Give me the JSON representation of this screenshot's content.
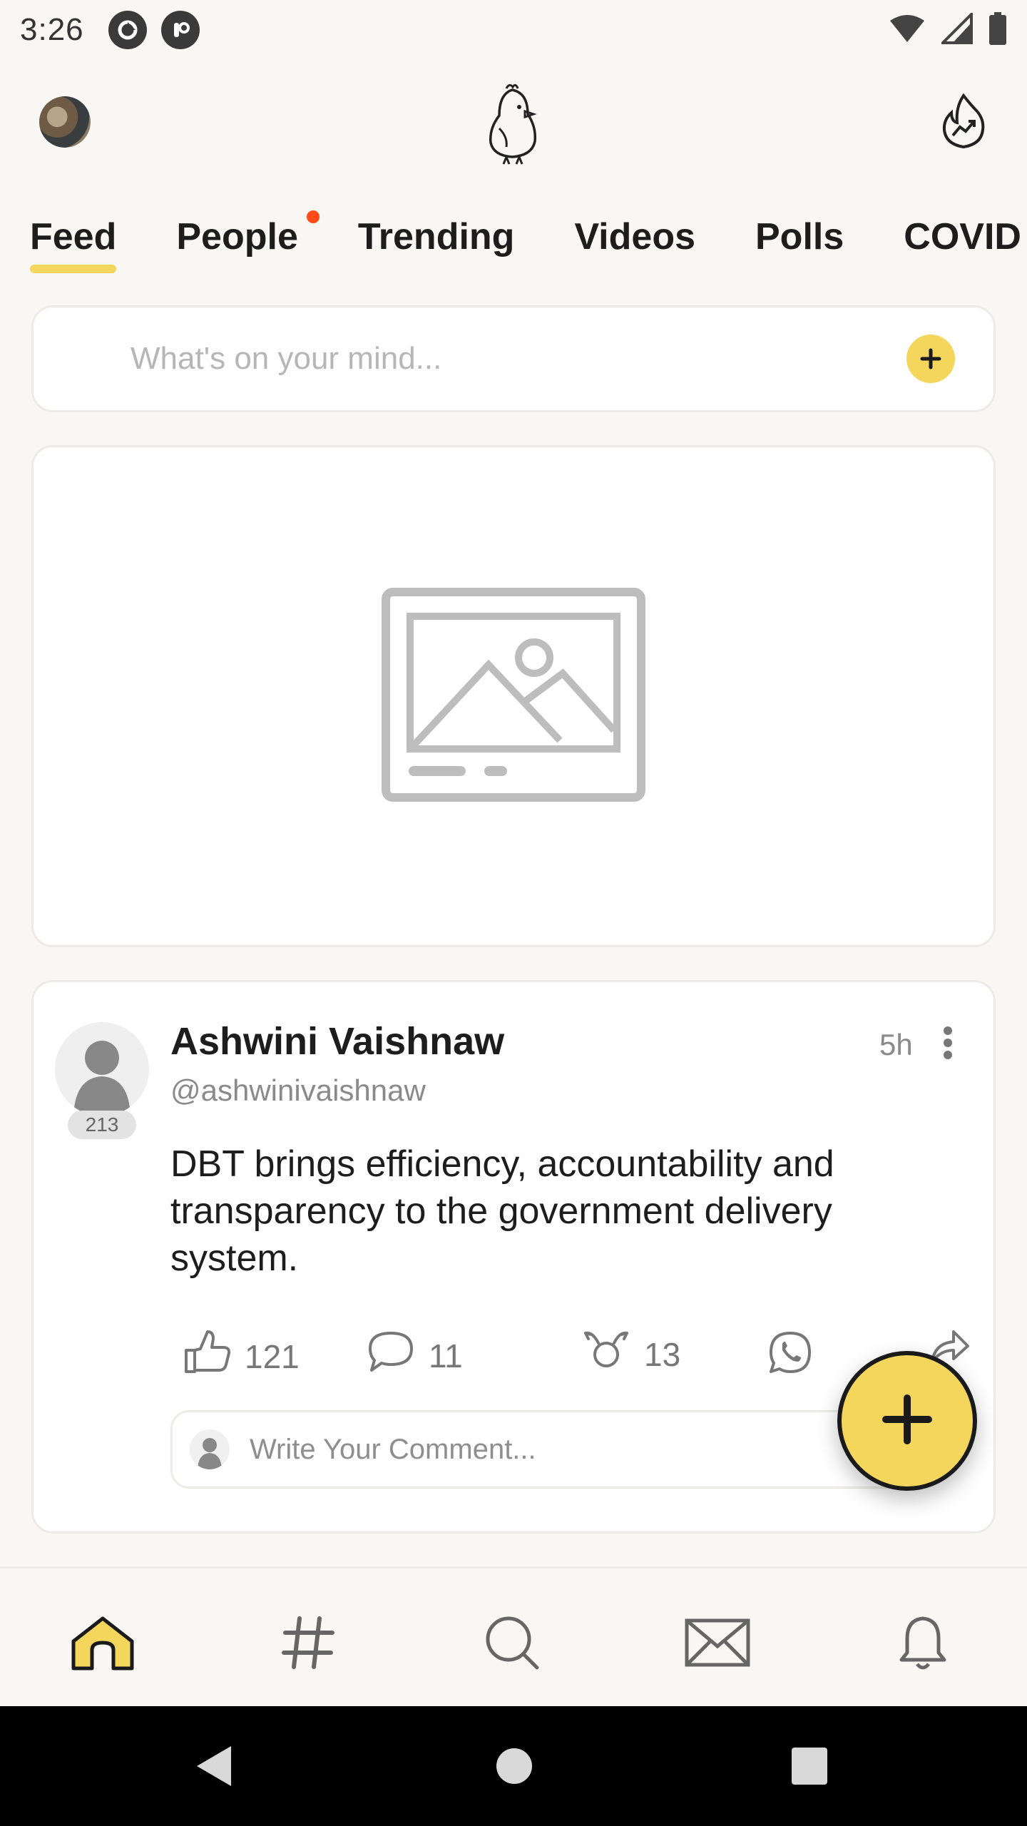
{
  "status_bar": {
    "time": "3:26",
    "icons": [
      "app-notification-icon",
      "app-notification-icon",
      "wifi-icon",
      "signal-icon",
      "battery-icon"
    ]
  },
  "header": {
    "logo": "koo-bird-logo",
    "right_icon": "trending-flame-icon"
  },
  "tabs": [
    {
      "label": "Feed",
      "active": true
    },
    {
      "label": "People",
      "has_dot": true
    },
    {
      "label": "Trending"
    },
    {
      "label": "Videos"
    },
    {
      "label": "Polls"
    },
    {
      "label": "COVID"
    }
  ],
  "composer": {
    "placeholder": "What's on your mind..."
  },
  "post": {
    "author": "Ashwini Vaishnaw",
    "handle": "@ashwinivaishnaw",
    "time": "5h",
    "avatar_badge": "213",
    "text": "DBT brings efficiency, accountability and transparency to the government delivery system.",
    "likes": "121",
    "comments": "11",
    "rekoos": "13",
    "comment_placeholder": "Write Your Comment..."
  },
  "bottom_nav": [
    "home-icon",
    "hashtag-icon",
    "search-icon",
    "mail-icon",
    "bell-icon"
  ],
  "colors": {
    "accent": "#f4d65c",
    "notification_dot": "#ff4b16",
    "background": "#f8f7f4"
  }
}
